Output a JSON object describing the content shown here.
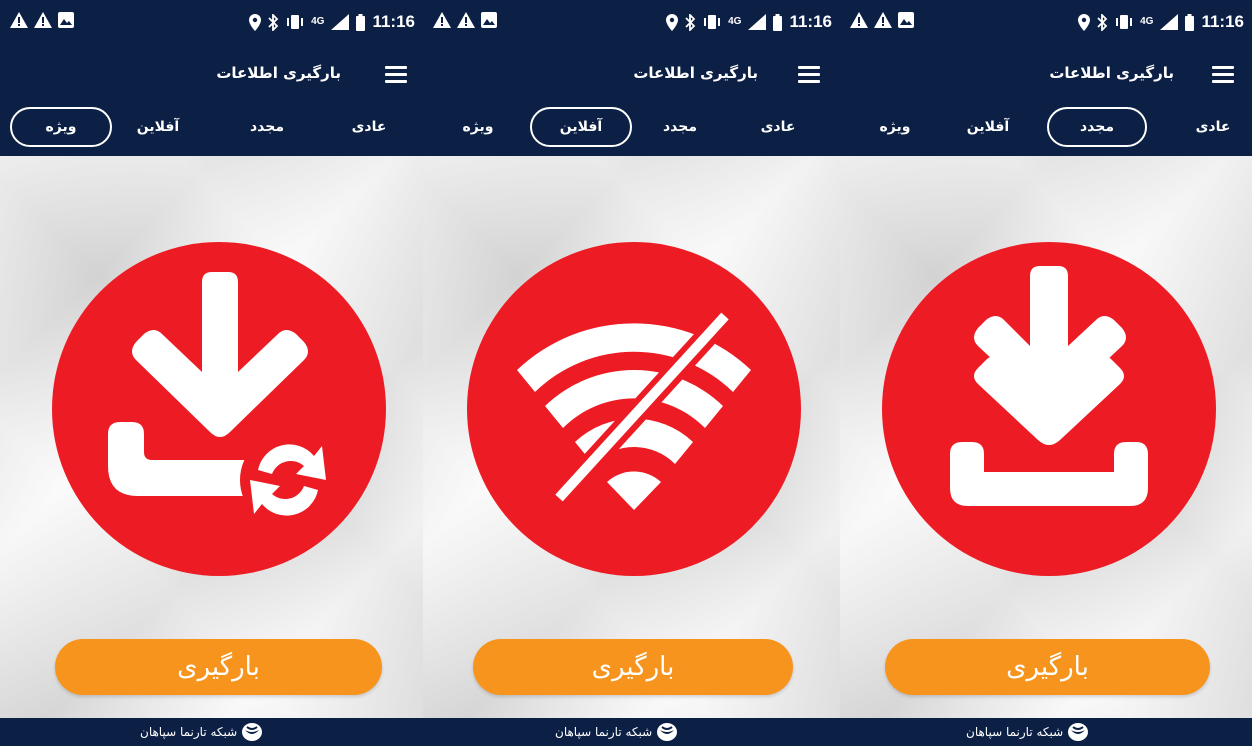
{
  "status_bar": {
    "time": "11:16",
    "network": "4G",
    "left_icons": [
      "warning-icon",
      "warning-icon",
      "image-icon"
    ],
    "right_icons": [
      "location-icon",
      "bluetooth-icon",
      "vibrate-icon",
      "signal-icon",
      "battery-icon"
    ]
  },
  "app_bar": {
    "title": "بارگیری اطلاعات",
    "menu_icon": "menu-icon"
  },
  "tabs": [
    "عادی",
    "مجدد",
    "آفلاین",
    "ویژه"
  ],
  "screens": [
    {
      "active_tab": "ویژه",
      "icon": "download-sync-icon",
      "button_label": "بارگیری"
    },
    {
      "active_tab": "آفلاین",
      "icon": "wifi-off-icon",
      "button_label": "بارگیری"
    },
    {
      "active_tab": "مجدد",
      "icon": "download-tray-icon",
      "button_label": "بارگیری"
    }
  ],
  "footer": {
    "text": "شبکه تارنما سپاهان",
    "logo_icon": "company-logo-icon"
  },
  "colors": {
    "header_bg": "#0c1f44",
    "circle": "#ed1c24",
    "button": "#f7941d"
  }
}
